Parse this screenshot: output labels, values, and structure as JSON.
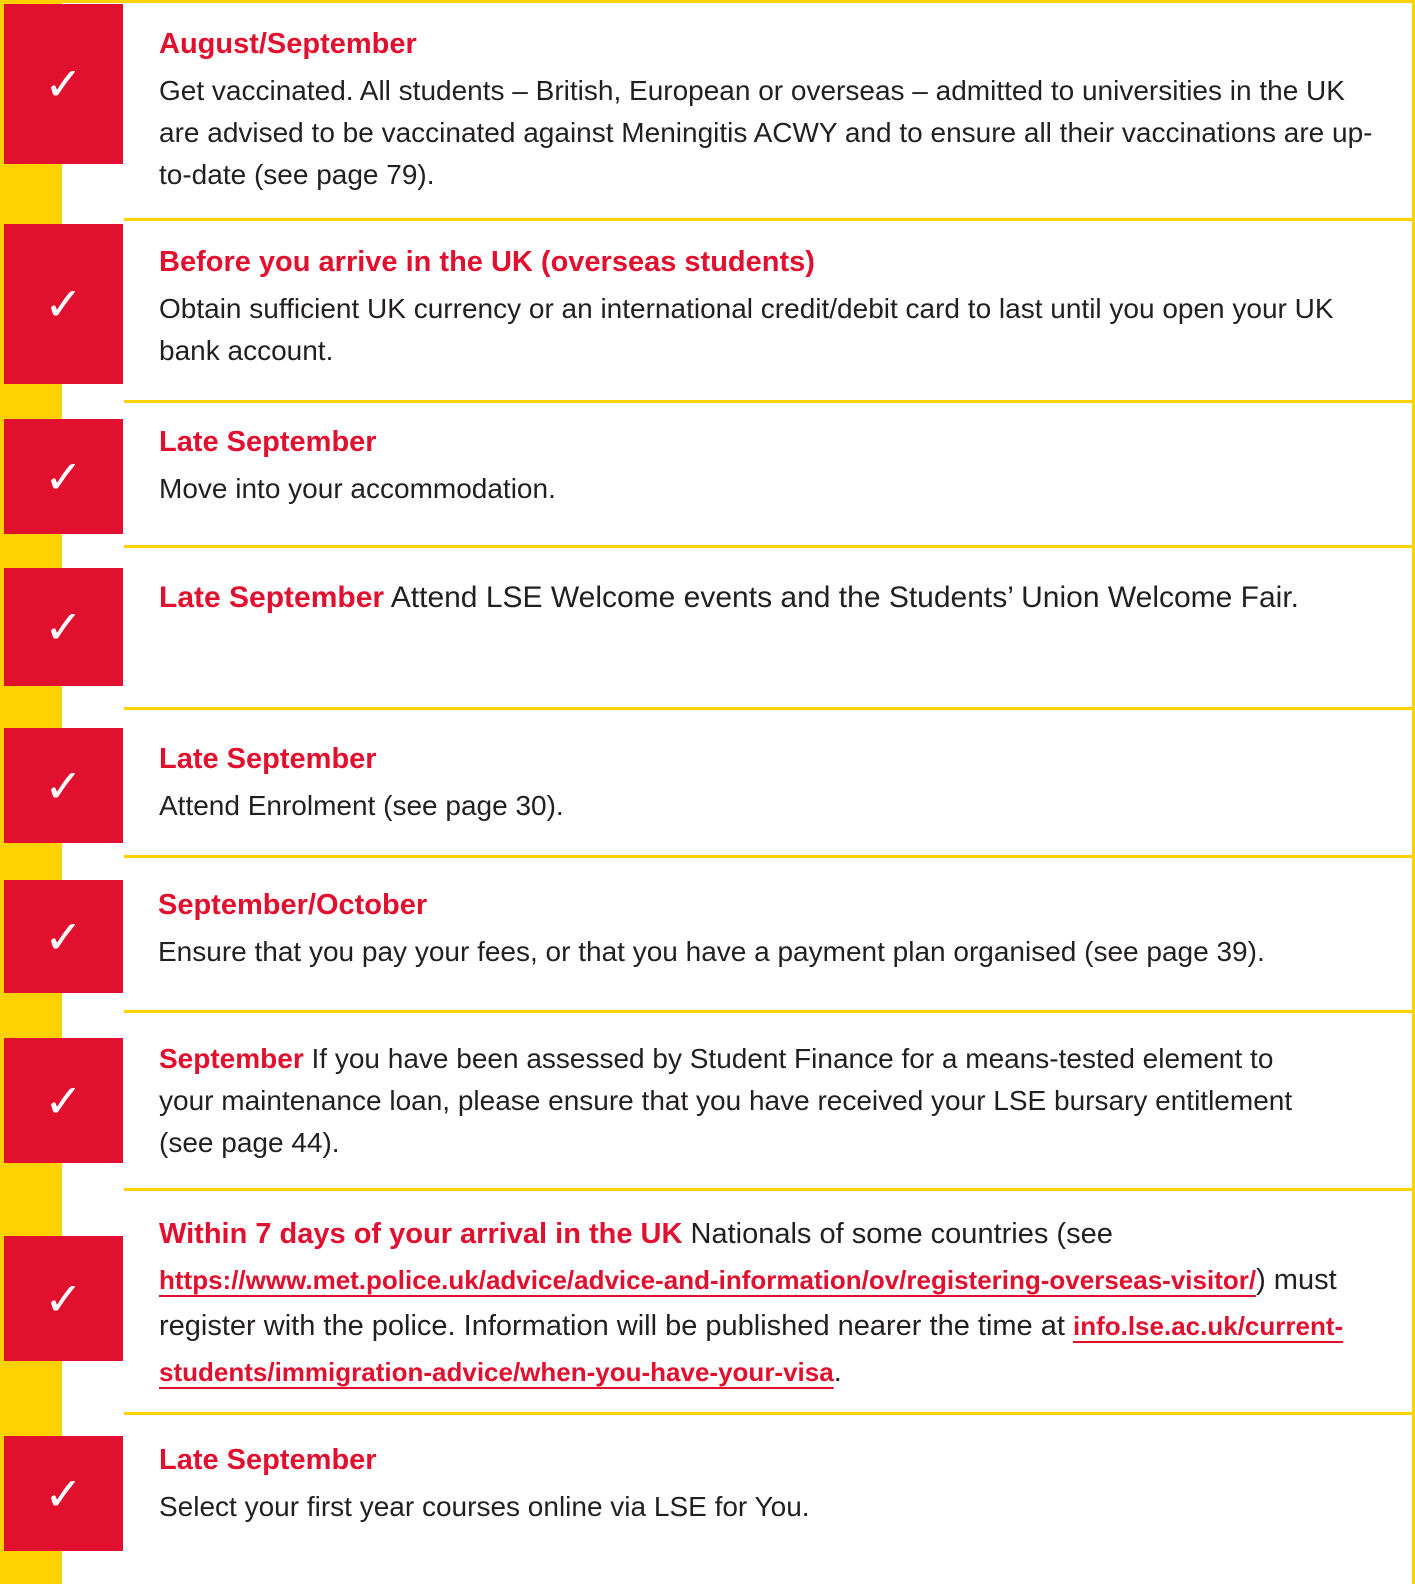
{
  "colors": {
    "accent_red": "#E1102E",
    "stripe_yellow": "#FFD100",
    "body_text": "#231F20"
  },
  "check_icon": {
    "glyph": "✓",
    "name": "check-icon"
  },
  "items": [
    {
      "title": "August/September",
      "text": "Get vaccinated. All students – British, European or overseas – admitted to universities in the UK are advised to be vaccinated against Meningitis ACWY and to ensure all their vaccinations are up-to-date ",
      "ref": "(see page 79)",
      "end": "."
    },
    {
      "title": "Before you arrive in the UK (overseas students)",
      "text": "Obtain sufficient UK currency or an international credit/debit card to last until you open your UK bank account."
    },
    {
      "title": "Late September",
      "text": "Move into your accommodation."
    },
    {
      "title": "Late September",
      "text": " Attend LSE Welcome events and the Students’ Union Welcome Fair."
    },
    {
      "title": "Late September",
      "text": "Attend Enrolment ",
      "ref": "(see page 30)",
      "end": "."
    },
    {
      "title": "September/October",
      "text": "Ensure that you pay your fees, or that you have a payment plan organised ",
      "ref": "(see page 39)",
      "end": "."
    },
    {
      "title": "September",
      "text": " If you have been assessed by Student Finance for a means-tested element to your maintenance loan, please ensure that you have received your LSE bursary entitlement ",
      "ref": "(see page 44)",
      "end": "."
    },
    {
      "title": "Within 7 days of your arrival in the UK",
      "text_a": " Nationals of some countries (see ",
      "link_1": "https://www.met.police.uk/advice/advice-and-information/ov/registering-overseas-visitor/",
      "text_b": ") must register with the police. Information will be published nearer the time at ",
      "link_2": "info.lse.ac.uk/current-students/immigration-advice/when-you-have-your-visa",
      "end": "."
    },
    {
      "title": "Late September",
      "text": "Select your first year courses online via LSE for You."
    }
  ]
}
